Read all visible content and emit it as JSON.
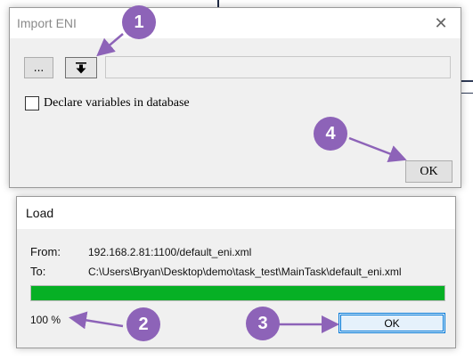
{
  "eni_dialog": {
    "title": "Import ENI",
    "close_glyph": "✕",
    "browse_label": "...",
    "download_icon": "download-arrow-icon",
    "path_value": "",
    "declare_checkbox_label": "Declare variables in database",
    "declare_checked": false,
    "ok_label": "OK"
  },
  "load_dialog": {
    "title": "Load",
    "from_label": "From:",
    "from_value": "192.168.2.81:1100/default_eni.xml",
    "to_label": "To:",
    "to_value": "C:\\Users\\Bryan\\Desktop\\demo\\task_test\\MainTask\\default_eni.xml",
    "progress": 1.0,
    "progress_color": "#06b025",
    "percent_text": "100 %",
    "ok_label": "OK"
  },
  "callouts": [
    {
      "number": "1"
    },
    {
      "number": "2"
    },
    {
      "number": "3"
    },
    {
      "number": "4"
    }
  ],
  "callout_color": "#8d63b8"
}
